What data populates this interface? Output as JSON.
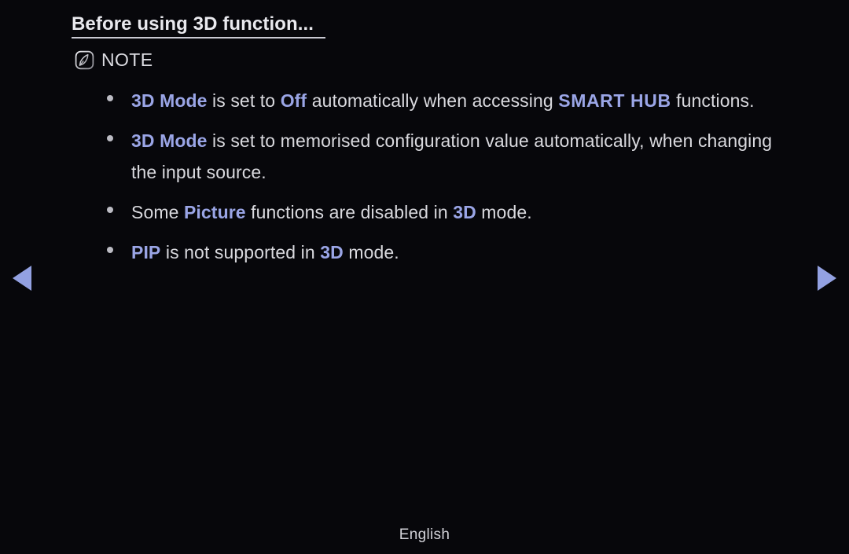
{
  "page": {
    "title": "Before using 3D function...",
    "background_color": "#07070b",
    "body_text_color": "#d9d9de",
    "highlight_color": "#9aa5e6",
    "arrow_color": "#93a1e2"
  },
  "note": {
    "icon": "note-pencil-icon",
    "label": "NOTE"
  },
  "bullets": [
    {
      "segments": [
        {
          "text": "3D Mode",
          "style": "highlight"
        },
        {
          "text": " is set to ",
          "style": "normal"
        },
        {
          "text": "Off",
          "style": "highlight"
        },
        {
          "text": " automatically when accessing ",
          "style": "normal"
        },
        {
          "text": "SMART HUB",
          "style": "highlight-wide"
        },
        {
          "text": " functions.",
          "style": "normal"
        }
      ]
    },
    {
      "segments": [
        {
          "text": "3D Mode",
          "style": "highlight"
        },
        {
          "text": " is set to memorised configuration value automatically, when changing the input source.",
          "style": "normal"
        }
      ]
    },
    {
      "segments": [
        {
          "text": "Some ",
          "style": "normal"
        },
        {
          "text": "Picture",
          "style": "highlight"
        },
        {
          "text": " functions are disabled in ",
          "style": "normal"
        },
        {
          "text": "3D",
          "style": "highlight"
        },
        {
          "text": " mode.",
          "style": "normal"
        }
      ]
    },
    {
      "segments": [
        {
          "text": "PIP",
          "style": "highlight"
        },
        {
          "text": " is not supported in ",
          "style": "normal"
        },
        {
          "text": "3D",
          "style": "highlight"
        },
        {
          "text": " mode.",
          "style": "normal"
        }
      ]
    }
  ],
  "nav": {
    "previous_label": "◀",
    "next_label": "▶"
  },
  "footer": {
    "language": "English"
  }
}
